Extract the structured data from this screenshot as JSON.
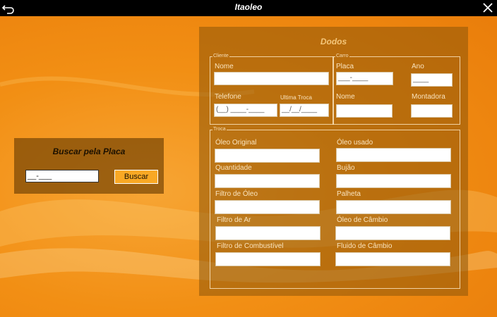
{
  "window": {
    "title": "Itaoleo",
    "back_icon": "back-arrow-icon",
    "close_icon": "close-icon"
  },
  "search": {
    "heading": "Buscar pela Placa",
    "plate_value": "__-___",
    "button_label": "Buscar"
  },
  "dados": {
    "heading": "Dodos",
    "cliente": {
      "legend": "Cliente",
      "nome_label": "Nome",
      "nome_value": "",
      "telefone_label": "Telefone",
      "telefone_value": "(__) ____-____",
      "ultima_troca_label": "Ultima Troca",
      "ultima_troca_value": "__/__/____"
    },
    "carro": {
      "legend": "Carro",
      "placa_label": "Placa",
      "placa_value": "___-____",
      "ano_label": "Ano",
      "ano_value": "____",
      "nome_label": "Nome",
      "nome_value": "",
      "montadora_label": "Montadora",
      "montadora_value": ""
    },
    "troca": {
      "legend": "Troca",
      "oleo_original_label": "Óleo Original",
      "oleo_usado_label": "Óleo usado",
      "quantidade_label": "Quantidade",
      "bujao_label": "Bujão",
      "filtro_oleo_label": "Filtro de Óleo",
      "palheta_label": "Palheta",
      "filtro_ar_label": "Filtro de Ar",
      "oleo_cambio_label": "Óleo de Câmbio",
      "filtro_combustivel_label": "Filtro de Combustível",
      "fluido_cambio_label": "Fluido de Câmbio"
    }
  },
  "colors": {
    "accent": "#f28f14",
    "panel": "#8c550a",
    "button": "#f9a824"
  }
}
